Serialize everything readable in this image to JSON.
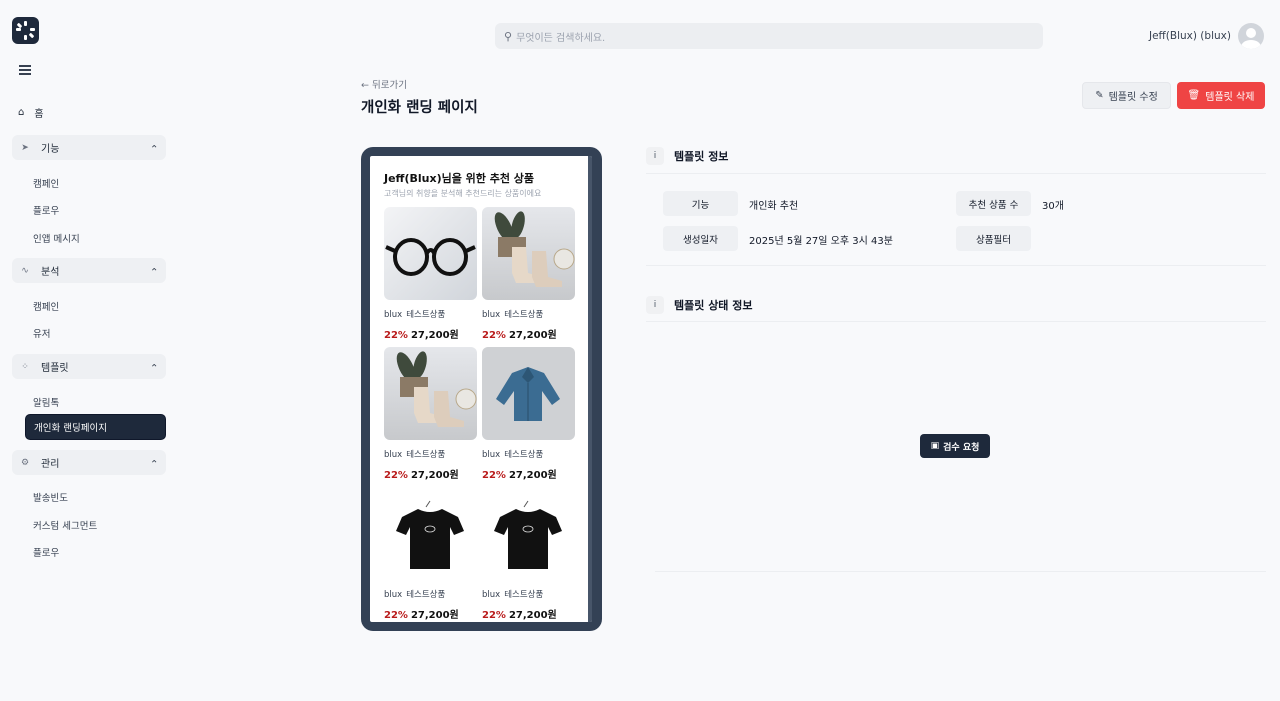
{
  "header": {
    "search_placeholder": "무엇이든 검색하세요.",
    "user_name": "Jeff(Blux) (blux)"
  },
  "sidebar": {
    "home": "홈",
    "groups": [
      {
        "label": "기능",
        "items": [
          "캠페인",
          "플로우",
          "인앱 메시지"
        ]
      },
      {
        "label": "분석",
        "items": [
          "캠페인",
          "유저"
        ]
      },
      {
        "label": "템플릿",
        "items": [
          "알림톡",
          "개인화 랜딩페이지"
        ]
      },
      {
        "label": "관리",
        "items": [
          "발송빈도",
          "커스텀 세그먼트",
          "플로우"
        ]
      }
    ],
    "active_item": "개인화 랜딩페이지"
  },
  "page": {
    "back_label": "← 뒤로가기",
    "title": "개인화 랜딩 페이지",
    "edit_button": "템플릿 수정",
    "delete_button": "템플릿 삭제"
  },
  "preview": {
    "title": "Jeff(Blux)님을 위한 추천 상품",
    "subtitle": "고객님의 취향을 분석해 추천드리는 상품이에요",
    "products": [
      {
        "brand": "blux",
        "name": "테스트상품",
        "discount": "22%",
        "price": "27,200원",
        "image": "glasses"
      },
      {
        "brand": "blux",
        "name": "테스트상품",
        "discount": "22%",
        "price": "27,200원",
        "image": "boots"
      },
      {
        "brand": "blux",
        "name": "테스트상품",
        "discount": "22%",
        "price": "27,200원",
        "image": "boots"
      },
      {
        "brand": "blux",
        "name": "테스트상품",
        "discount": "22%",
        "price": "27,200원",
        "image": "denim-shirt"
      },
      {
        "brand": "blux",
        "name": "테스트상품",
        "discount": "22%",
        "price": "27,200원",
        "image": "black-tshirt"
      },
      {
        "brand": "blux",
        "name": "테스트상품",
        "discount": "22%",
        "price": "27,200원",
        "image": "black-tshirt"
      }
    ]
  },
  "template_info": {
    "heading": "템플릿 정보",
    "feature_label": "기능",
    "feature_value": "개인화 추천",
    "count_label": "추천 상품 수",
    "count_value": "30개",
    "created_label": "생성일자",
    "created_value": "2025년 5월 27일 오후 3시 43분",
    "filter_label": "상품필터"
  },
  "template_status": {
    "heading": "템플릿 상태 정보",
    "review_button": "검수 요청"
  },
  "colors": {
    "primary": "#1e293b",
    "danger": "#ef4444",
    "discount": "#b91c1c"
  }
}
